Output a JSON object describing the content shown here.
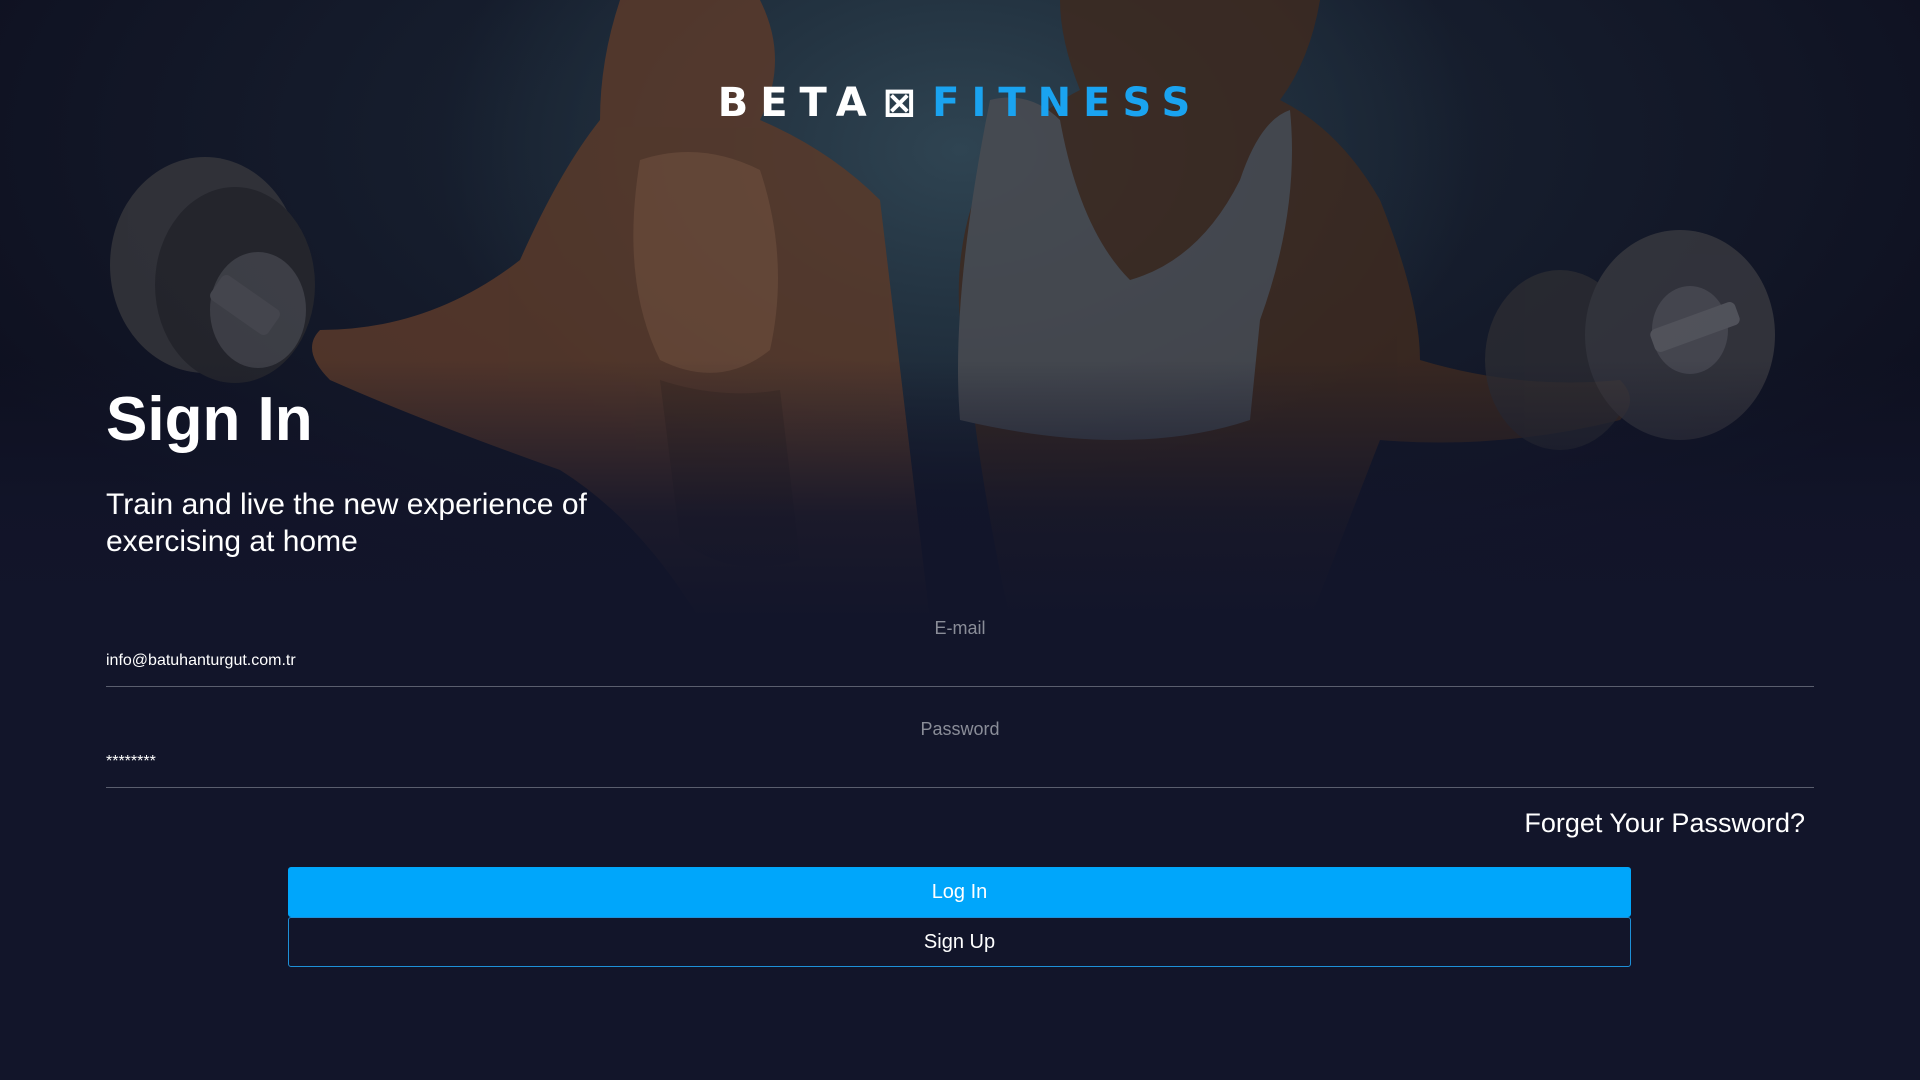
{
  "brand": {
    "logo_part1": "BETA",
    "logo_mark": "⊠",
    "logo_part2": "FITNESS",
    "accent_color": "#1aa3f0"
  },
  "hero": {
    "title": "Sign In",
    "subtitle": "Train and live the new experience of exercising at home"
  },
  "form": {
    "email": {
      "label": "E-mail",
      "value": "info@batuhanturgut.com.tr"
    },
    "password": {
      "label": "Password",
      "value": "********"
    },
    "forgot_link": "Forget Your Password?",
    "login_button": "Log In",
    "signup_button": "Sign Up"
  },
  "colors": {
    "background": "#12152a",
    "primary_button": "#00a6fb",
    "secondary_border": "#1e90d8"
  }
}
